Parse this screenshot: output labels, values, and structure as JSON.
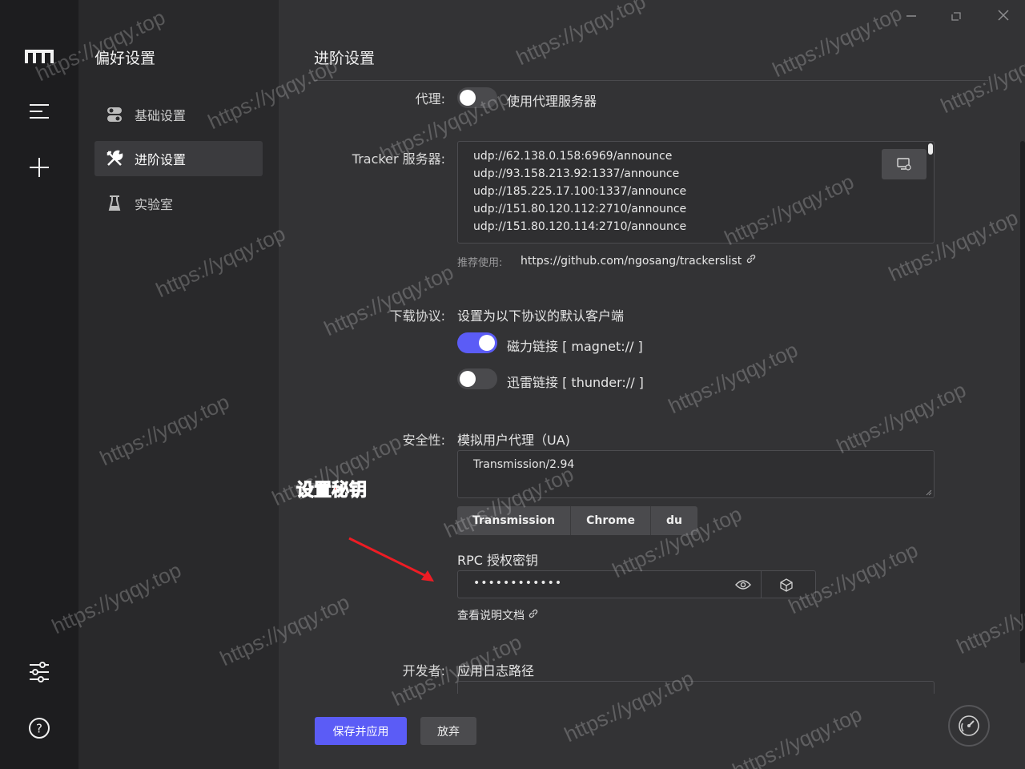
{
  "sidebar_rail": {
    "icons": [
      "logo-icon",
      "menu-icon",
      "plus-icon",
      "sliders-icon",
      "help-icon"
    ]
  },
  "nav": {
    "title": "偏好设置",
    "items": [
      {
        "label": "基础设置",
        "icon": "toggle-icon",
        "active": false
      },
      {
        "label": "进阶设置",
        "icon": "tools-icon",
        "active": true
      },
      {
        "label": "实验室",
        "icon": "flask-icon",
        "active": false
      }
    ]
  },
  "main": {
    "title": "进阶设置",
    "window_controls": [
      "minimize-icon",
      "maximize-icon",
      "close-icon"
    ],
    "proxy": {
      "label": "代理:",
      "toggle_label": "使用代理服务器",
      "enabled": false
    },
    "tracker": {
      "label": "Tracker 服务器:",
      "lines": [
        "udp://62.138.0.158:6969/announce",
        "udp://93.158.213.92:1337/announce",
        "udp://185.225.17.100:1337/announce",
        "udp://151.80.120.112:2710/announce",
        "udp://151.80.120.114:2710/announce"
      ],
      "hint_prefix": "推荐使用:",
      "hint_link": "https://github.com/ngosang/trackerslist"
    },
    "protocol": {
      "label": "下载协议:",
      "desc": "设置为以下协议的默认客户端",
      "magnet": {
        "label": "磁力链接 [ magnet:// ]",
        "enabled": true
      },
      "thunder": {
        "label": "迅雷链接 [ thunder:// ]",
        "enabled": false
      }
    },
    "security": {
      "label": "安全性:",
      "ua_title": "模拟用户代理（UA)",
      "ua_value": "Transmission/2.94",
      "ua_presets": [
        "Transmission",
        "Chrome",
        "du"
      ],
      "rpc_title": "RPC 授权密钥",
      "rpc_value": "••••••••••••",
      "doc_link": "查看说明文档"
    },
    "developer": {
      "label": "开发者:",
      "log_title": "应用日志路径"
    },
    "actions": {
      "save": "保存并应用",
      "cancel": "放弃"
    }
  },
  "annotation": {
    "text": "设置秘钥",
    "color": "#ff2a2a"
  },
  "watermark": "https://yqqy.top",
  "colors": {
    "accent": "#5b5cf6",
    "rail": "#1d1d1f",
    "nav": "#29292b",
    "main": "#333335"
  }
}
